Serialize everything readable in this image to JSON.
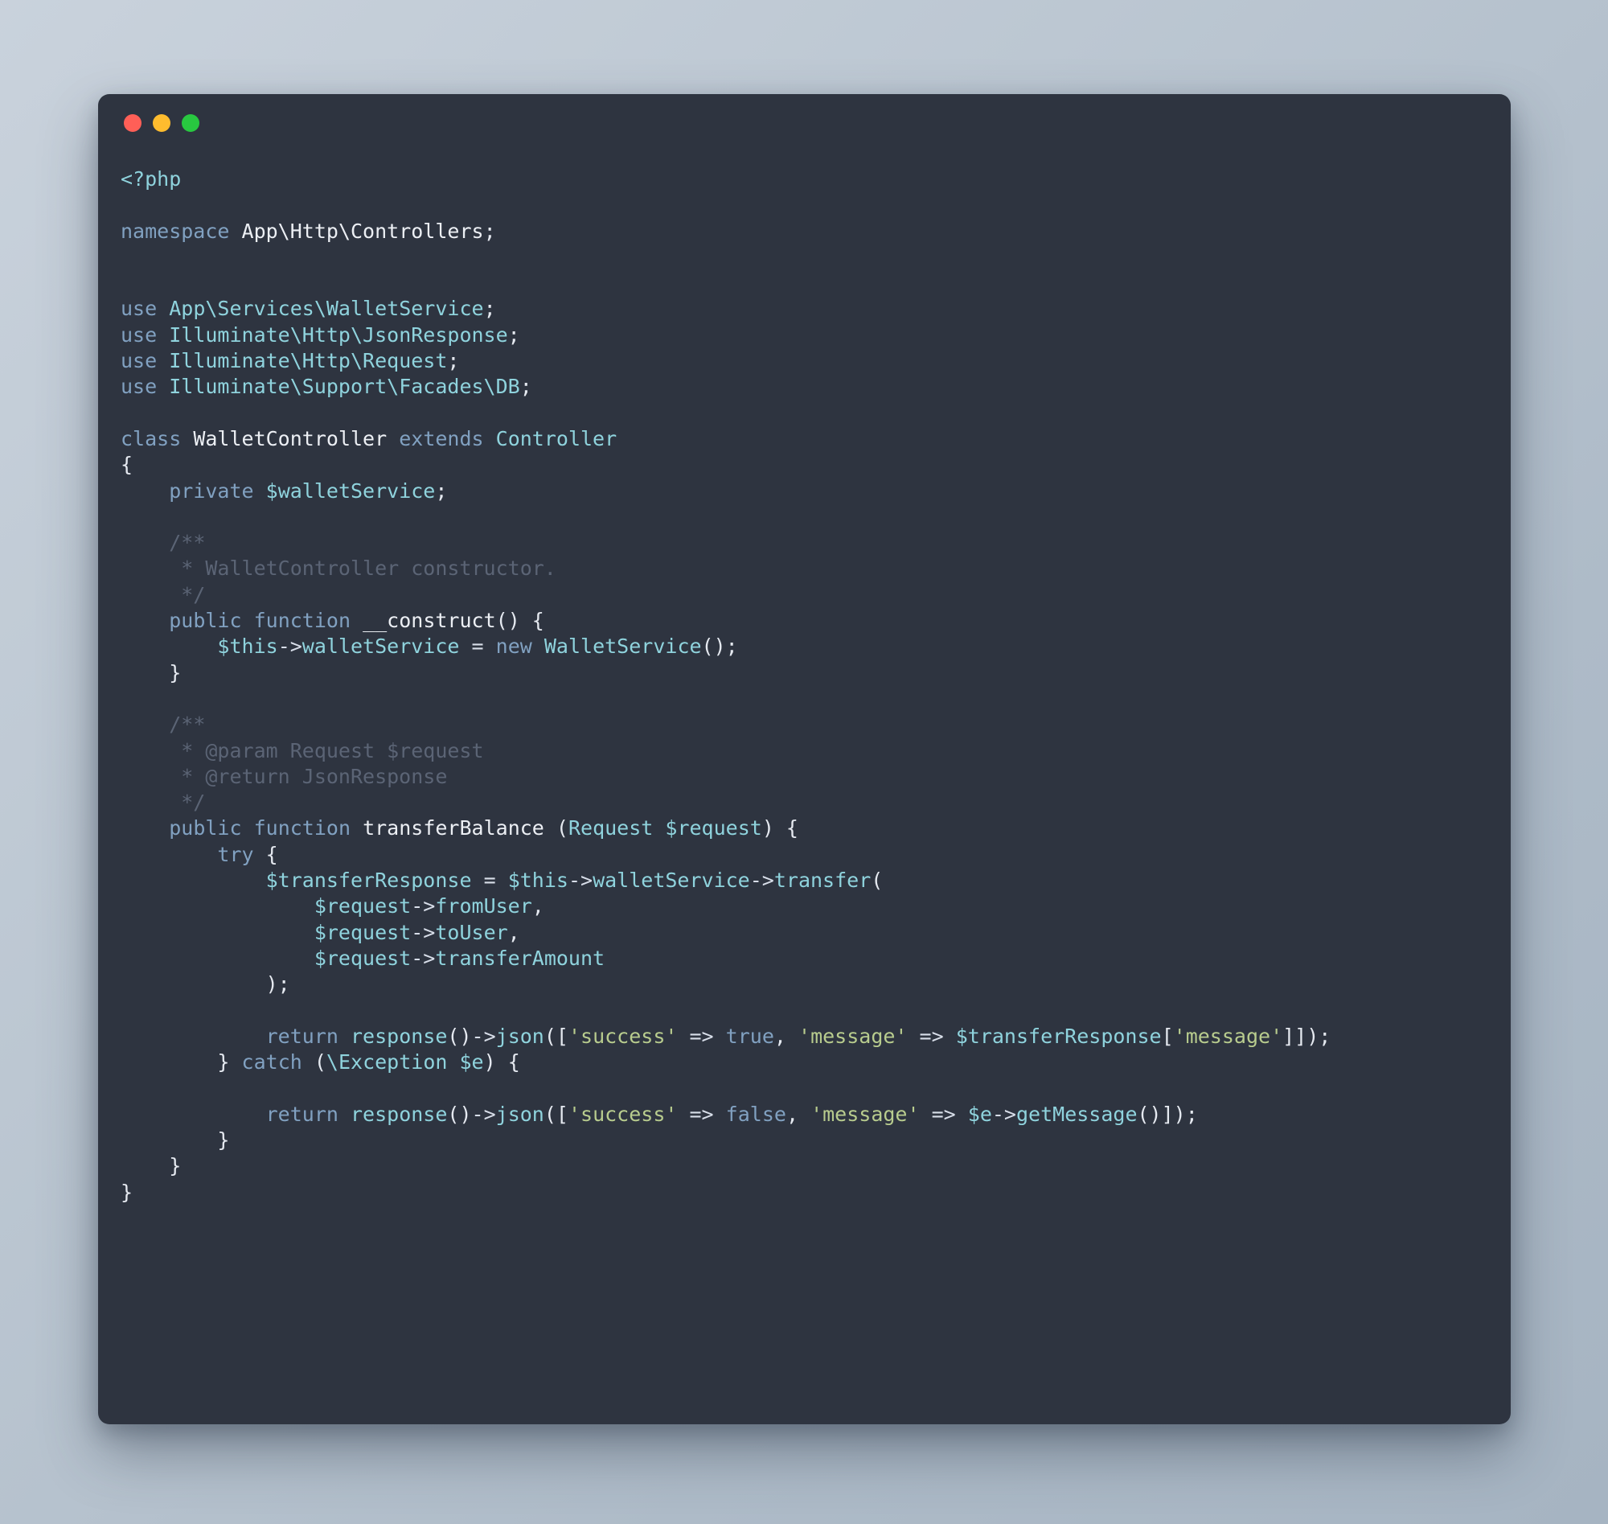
{
  "window": {
    "controls": [
      {
        "name": "close",
        "color": "#ff5f57"
      },
      {
        "name": "minimize",
        "color": "#febc2e"
      },
      {
        "name": "maximize",
        "color": "#28c840"
      }
    ]
  },
  "theme": {
    "background": "#2e3440",
    "page_background": "#bcc7d2",
    "keyword": "#81a1c1",
    "class": "#8fd3dd",
    "function": "#eceff4",
    "string": "#b8cc8e",
    "comment": "#5b6475",
    "punctuation": "#e5e9f0"
  },
  "code": {
    "language": "php",
    "lines": [
      [
        {
          "t": "<?php",
          "c": "cls"
        }
      ],
      [],
      [
        {
          "t": "namespace",
          "c": "kw"
        },
        {
          "t": " ",
          "c": "op"
        },
        {
          "t": "App\\Http\\Controllers",
          "c": "fn"
        },
        {
          "t": ";",
          "c": "pun"
        }
      ],
      [],
      [],
      [
        {
          "t": "use",
          "c": "kw"
        },
        {
          "t": " ",
          "c": "op"
        },
        {
          "t": "App\\Services\\WalletService",
          "c": "cls"
        },
        {
          "t": ";",
          "c": "pun"
        }
      ],
      [
        {
          "t": "use",
          "c": "kw"
        },
        {
          "t": " ",
          "c": "op"
        },
        {
          "t": "Illuminate\\Http\\JsonResponse",
          "c": "cls"
        },
        {
          "t": ";",
          "c": "pun"
        }
      ],
      [
        {
          "t": "use",
          "c": "kw"
        },
        {
          "t": " ",
          "c": "op"
        },
        {
          "t": "Illuminate\\Http\\Request",
          "c": "cls"
        },
        {
          "t": ";",
          "c": "pun"
        }
      ],
      [
        {
          "t": "use",
          "c": "kw"
        },
        {
          "t": " ",
          "c": "op"
        },
        {
          "t": "Illuminate\\Support\\Facades\\DB",
          "c": "cls"
        },
        {
          "t": ";",
          "c": "pun"
        }
      ],
      [],
      [
        {
          "t": "class",
          "c": "kw"
        },
        {
          "t": " ",
          "c": "op"
        },
        {
          "t": "WalletController",
          "c": "fn"
        },
        {
          "t": " ",
          "c": "op"
        },
        {
          "t": "extends",
          "c": "kw"
        },
        {
          "t": " ",
          "c": "op"
        },
        {
          "t": "Controller",
          "c": "cls"
        }
      ],
      [
        {
          "t": "{",
          "c": "pun"
        }
      ],
      [
        {
          "t": "    ",
          "c": "op"
        },
        {
          "t": "private",
          "c": "kw"
        },
        {
          "t": " ",
          "c": "op"
        },
        {
          "t": "$walletService",
          "c": "var"
        },
        {
          "t": ";",
          "c": "pun"
        }
      ],
      [],
      [
        {
          "t": "    ",
          "c": "op"
        },
        {
          "t": "/**",
          "c": "cmt"
        }
      ],
      [
        {
          "t": "     * WalletController constructor.",
          "c": "cmt"
        }
      ],
      [
        {
          "t": "     */",
          "c": "cmt"
        }
      ],
      [
        {
          "t": "    ",
          "c": "op"
        },
        {
          "t": "public",
          "c": "kw"
        },
        {
          "t": " ",
          "c": "op"
        },
        {
          "t": "function",
          "c": "kw"
        },
        {
          "t": " ",
          "c": "op"
        },
        {
          "t": "__construct",
          "c": "fn"
        },
        {
          "t": "() {",
          "c": "pun"
        }
      ],
      [
        {
          "t": "        ",
          "c": "op"
        },
        {
          "t": "$this",
          "c": "var"
        },
        {
          "t": "->",
          "c": "op"
        },
        {
          "t": "walletService",
          "c": "var"
        },
        {
          "t": " ",
          "c": "op"
        },
        {
          "t": "=",
          "c": "op"
        },
        {
          "t": " ",
          "c": "op"
        },
        {
          "t": "new",
          "c": "kw"
        },
        {
          "t": " ",
          "c": "op"
        },
        {
          "t": "WalletService",
          "c": "cls"
        },
        {
          "t": "();",
          "c": "pun"
        }
      ],
      [
        {
          "t": "    ",
          "c": "op"
        },
        {
          "t": "}",
          "c": "pun"
        }
      ],
      [],
      [
        {
          "t": "    ",
          "c": "op"
        },
        {
          "t": "/**",
          "c": "cmt"
        }
      ],
      [
        {
          "t": "     * @param Request $request",
          "c": "cmt"
        }
      ],
      [
        {
          "t": "     * @return JsonResponse",
          "c": "cmt"
        }
      ],
      [
        {
          "t": "     */",
          "c": "cmt"
        }
      ],
      [
        {
          "t": "    ",
          "c": "op"
        },
        {
          "t": "public",
          "c": "kw"
        },
        {
          "t": " ",
          "c": "op"
        },
        {
          "t": "function",
          "c": "kw"
        },
        {
          "t": " ",
          "c": "op"
        },
        {
          "t": "transferBalance",
          "c": "fn"
        },
        {
          "t": " (",
          "c": "pun"
        },
        {
          "t": "Request",
          "c": "cls"
        },
        {
          "t": " ",
          "c": "op"
        },
        {
          "t": "$request",
          "c": "var"
        },
        {
          "t": ") {",
          "c": "pun"
        }
      ],
      [
        {
          "t": "        ",
          "c": "op"
        },
        {
          "t": "try",
          "c": "kw"
        },
        {
          "t": " ",
          "c": "op"
        },
        {
          "t": "{",
          "c": "pun"
        }
      ],
      [
        {
          "t": "            ",
          "c": "op"
        },
        {
          "t": "$transferResponse",
          "c": "var"
        },
        {
          "t": " ",
          "c": "op"
        },
        {
          "t": "=",
          "c": "op"
        },
        {
          "t": " ",
          "c": "op"
        },
        {
          "t": "$this",
          "c": "var"
        },
        {
          "t": "->",
          "c": "op"
        },
        {
          "t": "walletService",
          "c": "var"
        },
        {
          "t": "->",
          "c": "op"
        },
        {
          "t": "transfer",
          "c": "var"
        },
        {
          "t": "(",
          "c": "pun"
        }
      ],
      [
        {
          "t": "                ",
          "c": "op"
        },
        {
          "t": "$request",
          "c": "var"
        },
        {
          "t": "->",
          "c": "op"
        },
        {
          "t": "fromUser",
          "c": "var"
        },
        {
          "t": ",",
          "c": "pun"
        }
      ],
      [
        {
          "t": "                ",
          "c": "op"
        },
        {
          "t": "$request",
          "c": "var"
        },
        {
          "t": "->",
          "c": "op"
        },
        {
          "t": "toUser",
          "c": "var"
        },
        {
          "t": ",",
          "c": "pun"
        }
      ],
      [
        {
          "t": "                ",
          "c": "op"
        },
        {
          "t": "$request",
          "c": "var"
        },
        {
          "t": "->",
          "c": "op"
        },
        {
          "t": "transferAmount",
          "c": "var"
        }
      ],
      [
        {
          "t": "            ",
          "c": "op"
        },
        {
          "t": ");",
          "c": "pun"
        }
      ],
      [],
      [
        {
          "t": "            ",
          "c": "op"
        },
        {
          "t": "return",
          "c": "kw"
        },
        {
          "t": " ",
          "c": "op"
        },
        {
          "t": "response",
          "c": "var"
        },
        {
          "t": "()",
          "c": "pun"
        },
        {
          "t": "->",
          "c": "op"
        },
        {
          "t": "json",
          "c": "var"
        },
        {
          "t": "([",
          "c": "pun"
        },
        {
          "t": "'success'",
          "c": "str"
        },
        {
          "t": " ",
          "c": "op"
        },
        {
          "t": "=>",
          "c": "op"
        },
        {
          "t": " ",
          "c": "op"
        },
        {
          "t": "true",
          "c": "kw"
        },
        {
          "t": ",",
          "c": "pun"
        },
        {
          "t": " ",
          "c": "op"
        },
        {
          "t": "'message'",
          "c": "str"
        },
        {
          "t": " ",
          "c": "op"
        },
        {
          "t": "=>",
          "c": "op"
        },
        {
          "t": " ",
          "c": "op"
        },
        {
          "t": "$transferResponse",
          "c": "var"
        },
        {
          "t": "[",
          "c": "pun"
        },
        {
          "t": "'message'",
          "c": "str"
        },
        {
          "t": "]]);",
          "c": "pun"
        }
      ],
      [
        {
          "t": "        ",
          "c": "op"
        },
        {
          "t": "}",
          "c": "pun"
        },
        {
          "t": " ",
          "c": "op"
        },
        {
          "t": "catch",
          "c": "kw"
        },
        {
          "t": " (",
          "c": "pun"
        },
        {
          "t": "\\Exception",
          "c": "cls"
        },
        {
          "t": " ",
          "c": "op"
        },
        {
          "t": "$e",
          "c": "var"
        },
        {
          "t": ") {",
          "c": "pun"
        }
      ],
      [],
      [
        {
          "t": "            ",
          "c": "op"
        },
        {
          "t": "return",
          "c": "kw"
        },
        {
          "t": " ",
          "c": "op"
        },
        {
          "t": "response",
          "c": "var"
        },
        {
          "t": "()",
          "c": "pun"
        },
        {
          "t": "->",
          "c": "op"
        },
        {
          "t": "json",
          "c": "var"
        },
        {
          "t": "([",
          "c": "pun"
        },
        {
          "t": "'success'",
          "c": "str"
        },
        {
          "t": " ",
          "c": "op"
        },
        {
          "t": "=>",
          "c": "op"
        },
        {
          "t": " ",
          "c": "op"
        },
        {
          "t": "false",
          "c": "kw"
        },
        {
          "t": ",",
          "c": "pun"
        },
        {
          "t": " ",
          "c": "op"
        },
        {
          "t": "'message'",
          "c": "str"
        },
        {
          "t": " ",
          "c": "op"
        },
        {
          "t": "=>",
          "c": "op"
        },
        {
          "t": " ",
          "c": "op"
        },
        {
          "t": "$e",
          "c": "var"
        },
        {
          "t": "->",
          "c": "op"
        },
        {
          "t": "getMessage",
          "c": "var"
        },
        {
          "t": "()]);",
          "c": "pun"
        }
      ],
      [
        {
          "t": "        ",
          "c": "op"
        },
        {
          "t": "}",
          "c": "pun"
        }
      ],
      [
        {
          "t": "    ",
          "c": "op"
        },
        {
          "t": "}",
          "c": "pun"
        }
      ],
      [
        {
          "t": "}",
          "c": "pun"
        }
      ]
    ]
  }
}
